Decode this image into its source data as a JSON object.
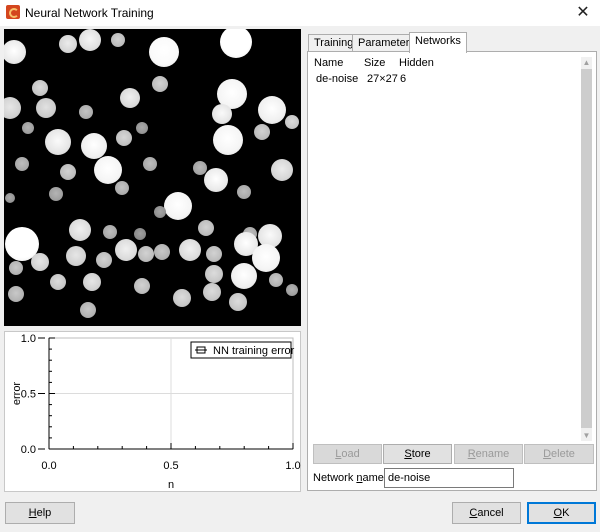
{
  "window": {
    "title": "Neural Network Training",
    "close_glyph": "✕"
  },
  "chart": {
    "chart_data": {
      "type": "line",
      "series": [
        {
          "name": "NN training error",
          "values": []
        }
      ],
      "xlabel": "n",
      "ylabel": "error",
      "xlim": [
        0.0,
        1.0
      ],
      "ylim": [
        0.0,
        1.0
      ],
      "x_ticks": [
        "0.0",
        "0.5",
        "1.0"
      ],
      "y_ticks": [
        "0.0",
        "0.5",
        "1.0"
      ],
      "grid": true,
      "legend_position": "top-right"
    }
  },
  "tabs": [
    {
      "label": "Training",
      "active": false
    },
    {
      "label": "Parameters",
      "active": false
    },
    {
      "label": "Networks",
      "active": true
    }
  ],
  "networks": {
    "columns": {
      "name": "Name",
      "size": "Size",
      "hidden": "Hidden"
    },
    "rows": [
      {
        "name": "de-noise",
        "size": "27×27",
        "hidden": "6"
      }
    ]
  },
  "buttons": {
    "load": {
      "prefix": "",
      "mnemonic": "L",
      "rest": "oad",
      "enabled": false
    },
    "store": {
      "prefix": "",
      "mnemonic": "S",
      "rest": "tore",
      "enabled": true
    },
    "rename": {
      "prefix": "",
      "mnemonic": "R",
      "rest": "ename",
      "enabled": false
    },
    "delete": {
      "prefix": "",
      "mnemonic": "D",
      "rest": "elete",
      "enabled": false
    }
  },
  "network_name": {
    "label_prefix": "Network ",
    "label_mnemonic": "n",
    "label_rest": "ame:",
    "value": "de-noise"
  },
  "footer": {
    "help": {
      "prefix": "",
      "mnemonic": "H",
      "rest": "elp"
    },
    "cancel": {
      "prefix": "",
      "mnemonic": "C",
      "rest": "ancel"
    },
    "ok": {
      "prefix": "",
      "mnemonic": "O",
      "rest": "K"
    }
  },
  "icons": {
    "app": "app-logo-icon",
    "close": "close-icon",
    "scroll_up": "chevron-up-icon",
    "scroll_down": "chevron-down-icon",
    "legend": "legend-line-icon"
  }
}
